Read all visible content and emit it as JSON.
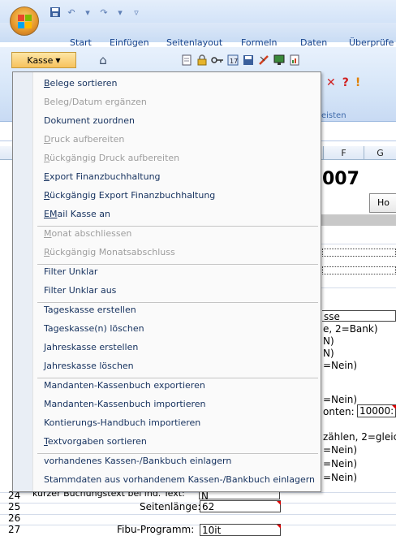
{
  "app": {
    "tabs": [
      "Start",
      "Einfügen",
      "Seitenlayout",
      "Formeln",
      "Daten",
      "Überprüfe"
    ]
  },
  "ribbon": {
    "kasse_label": "Kasse",
    "group_label": "eisten",
    "right_icons": [
      "✕",
      "?",
      "!"
    ]
  },
  "sheet": {
    "columns": [
      "F",
      "G"
    ],
    "year_fragment": "007",
    "button_fragment": "Ho",
    "fragments": [
      {
        "id": "sse",
        "text": "sse"
      },
      {
        "id": "bank",
        "text": "e, 2=Bank)"
      },
      {
        "id": "n1",
        "text": "N)"
      },
      {
        "id": "n2",
        "text": "N)"
      },
      {
        "id": "nein1",
        "text": "=Nein)"
      },
      {
        "id": "nein2",
        "text": "=Nein)"
      },
      {
        "id": "onten",
        "text": "onten:"
      },
      {
        "id": "zaehlen",
        "text": "zählen, 2=gleic"
      },
      {
        "id": "nein3",
        "text": "=Nein)"
      },
      {
        "id": "nein4",
        "text": "=Nein)"
      },
      {
        "id": "nein5",
        "text": "=Nein)"
      }
    ],
    "konten_value": "10000:",
    "rows": [
      {
        "num": "24",
        "label": "kurzer Buchungstext bei ind. Text:",
        "value": "N"
      },
      {
        "num": "25",
        "label": "Seitenlänge:",
        "value": "62"
      },
      {
        "num": "26",
        "label": "",
        "value": ""
      },
      {
        "num": "27",
        "label": "Fibu-Programm:",
        "value": "10it"
      }
    ]
  },
  "menu": {
    "groups": [
      [
        {
          "key": "B",
          "rest": "elege sortieren",
          "enabled": true
        },
        {
          "key": "",
          "rest": "Beleg/Datum ergänzen",
          "enabled": false
        },
        {
          "key": "",
          "rest": "Dokument zuordnen",
          "enabled": true
        },
        {
          "key": "D",
          "rest": "ruck aufbereiten",
          "enabled": false
        },
        {
          "key": "R",
          "rest": "ückgängig Druck aufbereiten",
          "enabled": false
        },
        {
          "key": "E",
          "rest": "xport Finanzbuchhaltung",
          "enabled": true
        },
        {
          "key": "R",
          "rest": "ückgängig Export Finanzbuchhaltung",
          "enabled": true
        },
        {
          "key": "EM",
          "rest": "ail Kasse an",
          "enabled": true
        }
      ],
      [
        {
          "key": "M",
          "rest": "onat abschliessen",
          "enabled": false
        },
        {
          "key": "R",
          "rest": "ückgängig Monatsabschluss",
          "enabled": false
        }
      ],
      [
        {
          "key": "",
          "rest": "Filter Unklar",
          "enabled": true
        },
        {
          "key": "",
          "rest": "Filter Unklar aus",
          "enabled": true
        }
      ],
      [
        {
          "key": "",
          "rest": "Tageskasse erstellen",
          "enabled": true
        },
        {
          "key": "",
          "rest": "Tageskasse(n) löschen",
          "enabled": true
        },
        {
          "key": "",
          "rest": "Jahreskasse erstellen",
          "enabled": true
        },
        {
          "key": "",
          "rest": "Jahreskasse löschen",
          "enabled": true
        }
      ],
      [
        {
          "key": "",
          "rest": "Mandanten-Kassenbuch exportieren",
          "enabled": true
        },
        {
          "key": "",
          "rest": "Mandanten-Kassenbuch importieren",
          "enabled": true
        },
        {
          "key": "",
          "rest": "Kontierungs-Handbuch importieren",
          "enabled": true
        },
        {
          "key": "T",
          "rest": "extvorgaben sortieren",
          "enabled": true
        }
      ],
      [
        {
          "key": "",
          "rest": "vorhandenes Kassen-/Bankbuch einlagern",
          "enabled": true
        },
        {
          "key": "",
          "rest": "Stammdaten aus vorhandenem Kassen-/Bankbuch einlagern",
          "enabled": true
        }
      ]
    ]
  }
}
